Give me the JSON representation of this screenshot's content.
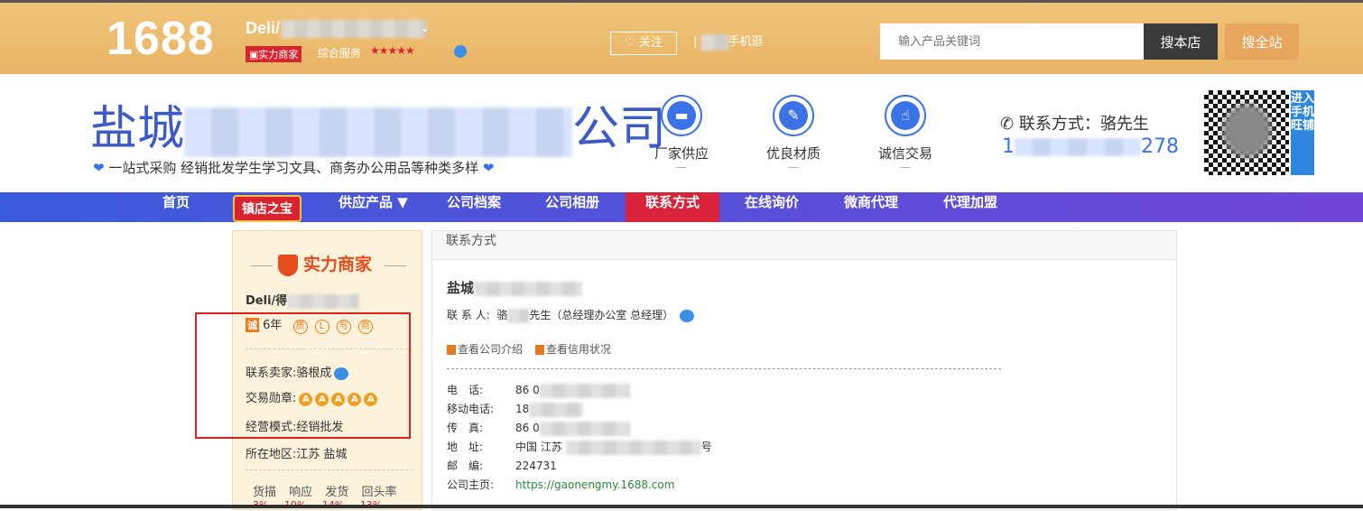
{
  "header": {
    "logo": "1688",
    "shop_name": "Deli/",
    "badge": "实力商家",
    "service_label": "综合服务",
    "stars": "★★★★★",
    "follow_label": "关注",
    "mobile_label": "手机逛",
    "search_placeholder": "输入产品关键词",
    "search_shop_label": "搜本店",
    "search_all_label": "搜全站"
  },
  "brand": {
    "name_prefix": "盐城",
    "name_suffix": "公司",
    "slogan": "一站式采购 经销批发学生学习文具、商务办公用品等种类多样",
    "features": [
      {
        "label": "厂家供应",
        "icon": "truck-icon"
      },
      {
        "label": "优良材质",
        "icon": "pencil-icon"
      },
      {
        "label": "诚信交易",
        "icon": "hand-icon"
      }
    ],
    "contact_label": "联系方式：骆先生",
    "phone_prefix": "1",
    "phone_suffix": "278",
    "qr_side_label": "进入手机旺铺"
  },
  "nav": {
    "items": [
      "首页",
      "镇店之宝",
      "供应产品 ▼",
      "公司档案",
      "公司相册",
      "联系方式",
      "在线询价",
      "微商代理",
      "代理加盟"
    ],
    "active": "联系方式"
  },
  "sidebar": {
    "title": "实力商家",
    "shop": "Deli/得",
    "years": "6年",
    "badges": [
      "质",
      "L",
      "与",
      "商"
    ],
    "seller_label": "联系卖家:骆根成",
    "medal_label": "交易勋章:",
    "mode_label": "经营模式:经销批发",
    "region_label": "所在地区:江苏 盐城",
    "stats_labels": [
      "货描",
      "响应",
      "发货",
      "回头率"
    ],
    "stats_values": [
      "3%",
      "10%",
      "14%",
      "13%"
    ]
  },
  "panel": {
    "title": "联系方式",
    "company_prefix": "盐城",
    "contact_person_label": "联 系 人:",
    "contact_person_first": "骆",
    "contact_person_rest": "先生（总经理办公室 总经理）",
    "link_intro": "查看公司介绍",
    "link_credit": "查看信用状况",
    "fields": [
      {
        "label": "电　话:",
        "value": "86 0"
      },
      {
        "label": "移动电话:",
        "value": "18"
      },
      {
        "label": "传　真:",
        "value": "86 0"
      },
      {
        "label": "地　址:",
        "value": "中国 江苏"
      },
      {
        "label": "邮　编:",
        "value": "224731"
      },
      {
        "label": "公司主页:",
        "value": "https://gaonengmy.1688.com"
      }
    ],
    "address_suffix": "号"
  },
  "colors": {
    "topbar": "#e9b465",
    "nav_start": "#3b5bdb",
    "nav_end": "#7046d8",
    "nav_active": "#d9233a",
    "brand_blue": "#3b5bc9",
    "highlight_box": "#e02020"
  }
}
